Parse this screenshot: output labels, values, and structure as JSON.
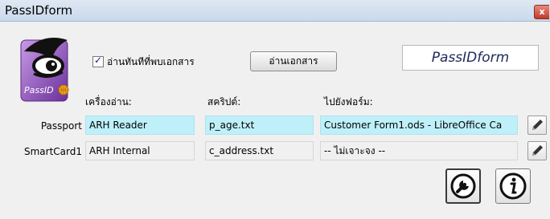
{
  "window": {
    "title": "PassIDform",
    "close_glyph": "x"
  },
  "logo": {
    "text": "PassID"
  },
  "auto_read": {
    "label": "อ่านทันทีที่พบเอกสาร",
    "checked": true,
    "check_glyph": "✓"
  },
  "read_button": {
    "label": "อ่านเอกสาร"
  },
  "brand": {
    "text": "PassIDform"
  },
  "columns": {
    "reader": "เครื่องอ่าน:",
    "script": "สคริปต์:",
    "form": "ไปยังฟอร์ม:"
  },
  "rows": [
    {
      "label": "Passport",
      "reader": "ARH Reader",
      "script": "p_age.txt",
      "form": "Customer Form1.ods - LibreOffice Ca"
    },
    {
      "label": "SmartCard1",
      "reader": "ARH Internal",
      "script": "c_address.txt",
      "form": "-- ไม่เจาะจง --"
    }
  ],
  "icons": {
    "edit": "pencil-icon",
    "settings": "wrench-icon",
    "info": "info-icon"
  },
  "colors": {
    "highlight": "#bff0fa",
    "logo_purple": "#8c4bb8"
  }
}
